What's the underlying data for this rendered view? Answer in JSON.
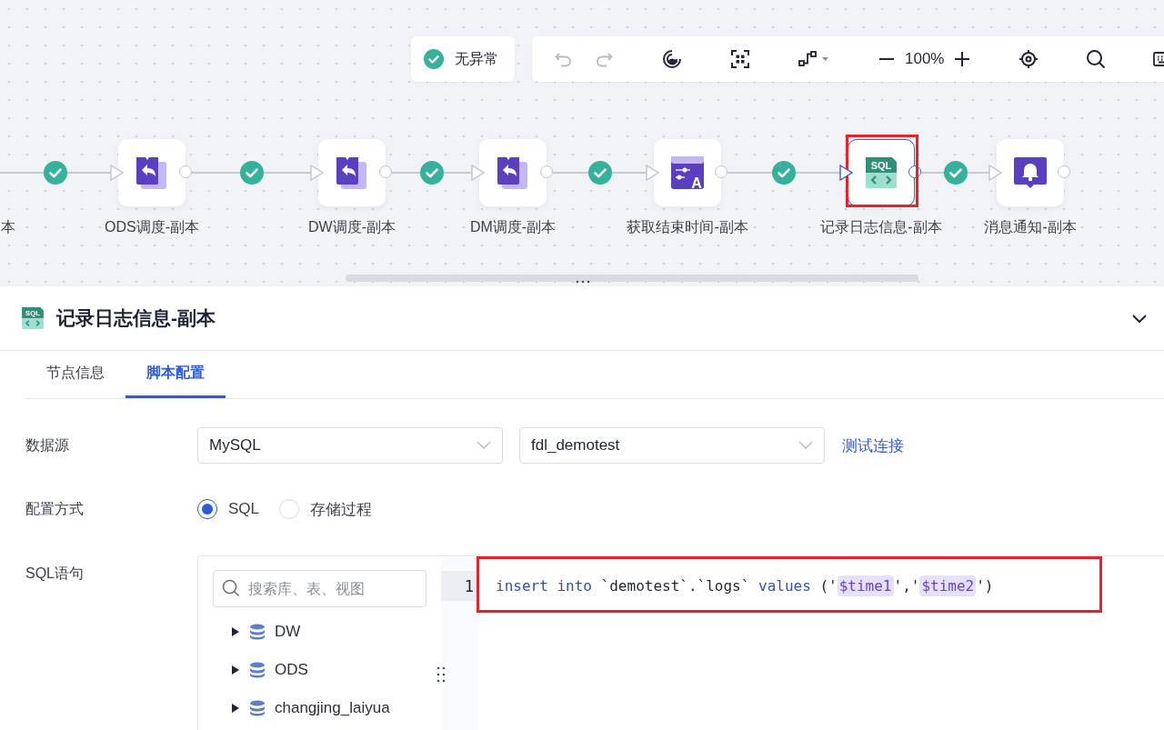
{
  "canvas": {
    "status": {
      "label": "无异常",
      "ok": true
    },
    "toolbar": {
      "undo_disabled": true,
      "redo_disabled": true,
      "zoom": "100%"
    },
    "cut_label": "本",
    "edges": [
      {
        "ok": true
      },
      {
        "ok": true
      },
      {
        "ok": true
      },
      {
        "ok": true
      },
      {
        "ok": true
      },
      {
        "ok": true
      }
    ],
    "nodes": [
      {
        "label": "ODS调度-副本",
        "kind": "dispatch",
        "selected": false,
        "highlighted": false
      },
      {
        "label": "DW调度-副本",
        "kind": "dispatch",
        "selected": false,
        "highlighted": false
      },
      {
        "label": "DM调度-副本",
        "kind": "dispatch",
        "selected": false,
        "highlighted": false
      },
      {
        "label": "获取结束时间-副本",
        "kind": "assign",
        "icon_text": "A",
        "selected": false,
        "highlighted": false
      },
      {
        "label": "记录日志信息-副本",
        "kind": "sql",
        "icon_text": "SQL",
        "selected": true,
        "highlighted": true
      },
      {
        "label": "消息通知-副本",
        "kind": "notify",
        "selected": false,
        "highlighted": false
      }
    ]
  },
  "panel": {
    "icon_text": "SQL",
    "title": "记录日志信息-副本",
    "expanded": true,
    "tabs": [
      {
        "label": "节点信息",
        "selected": false
      },
      {
        "label": "脚本配置",
        "selected": true
      }
    ],
    "datasource": {
      "label": "数据源",
      "type": "MySQL",
      "database": "fdl_demotest",
      "link": "测试连接"
    },
    "mode": {
      "label": "配置方式",
      "options": [
        {
          "label": "SQL",
          "selected": true
        },
        {
          "label": "存储过程",
          "selected": false
        }
      ]
    },
    "sql": {
      "label": "SQL语句",
      "search_placeholder": "搜索库、表、视图",
      "tree": [
        {
          "label": "DW",
          "expanded": false
        },
        {
          "label": "ODS",
          "expanded": false
        },
        {
          "label": "changjing_laiyua",
          "expanded": false
        }
      ],
      "lines": [
        {
          "number": "1",
          "highlighted": true,
          "tokens": [
            {
              "kind": "keyword",
              "text": "insert into"
            },
            {
              "kind": "plain",
              "text": " `demotest`.`logs` "
            },
            {
              "kind": "keyword",
              "text": "values"
            },
            {
              "kind": "plain",
              "text": " ('"
            },
            {
              "kind": "variable",
              "text": "$time1"
            },
            {
              "kind": "plain",
              "text": "','"
            },
            {
              "kind": "variable",
              "text": "$time2"
            },
            {
              "kind": "plain",
              "text": "')"
            }
          ]
        }
      ]
    }
  }
}
